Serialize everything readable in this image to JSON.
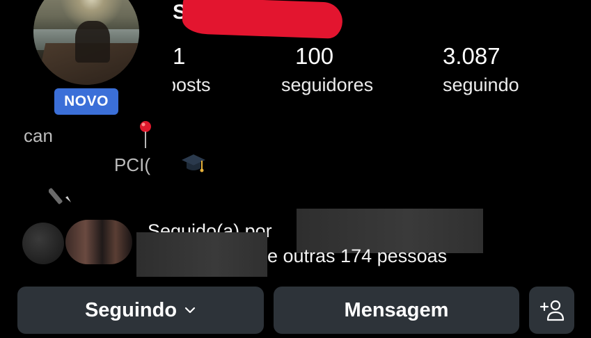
{
  "profile": {
    "name_initial": "S",
    "badge": "NOVO"
  },
  "stats": [
    {
      "value": "1",
      "label": "posts"
    },
    {
      "value": "100",
      "label": "seguidores"
    },
    {
      "value": "3.087",
      "label": "seguindo"
    }
  ],
  "bio": {
    "line1": "can",
    "line2": "PCI("
  },
  "followed_by": {
    "prefix": "Seguido(a) por",
    "suffix": "e outras 174 pessoas"
  },
  "actions": {
    "following_label": "Seguindo",
    "message_label": "Mensagem"
  },
  "colors": {
    "badge": "#3b6fd8",
    "button_bg": "#2d3339",
    "redaction": "#e3152f"
  },
  "icons": [
    "chevron-down-icon",
    "add-person-icon",
    "pin-icon",
    "graduation-cap-icon",
    "pen-icon"
  ]
}
